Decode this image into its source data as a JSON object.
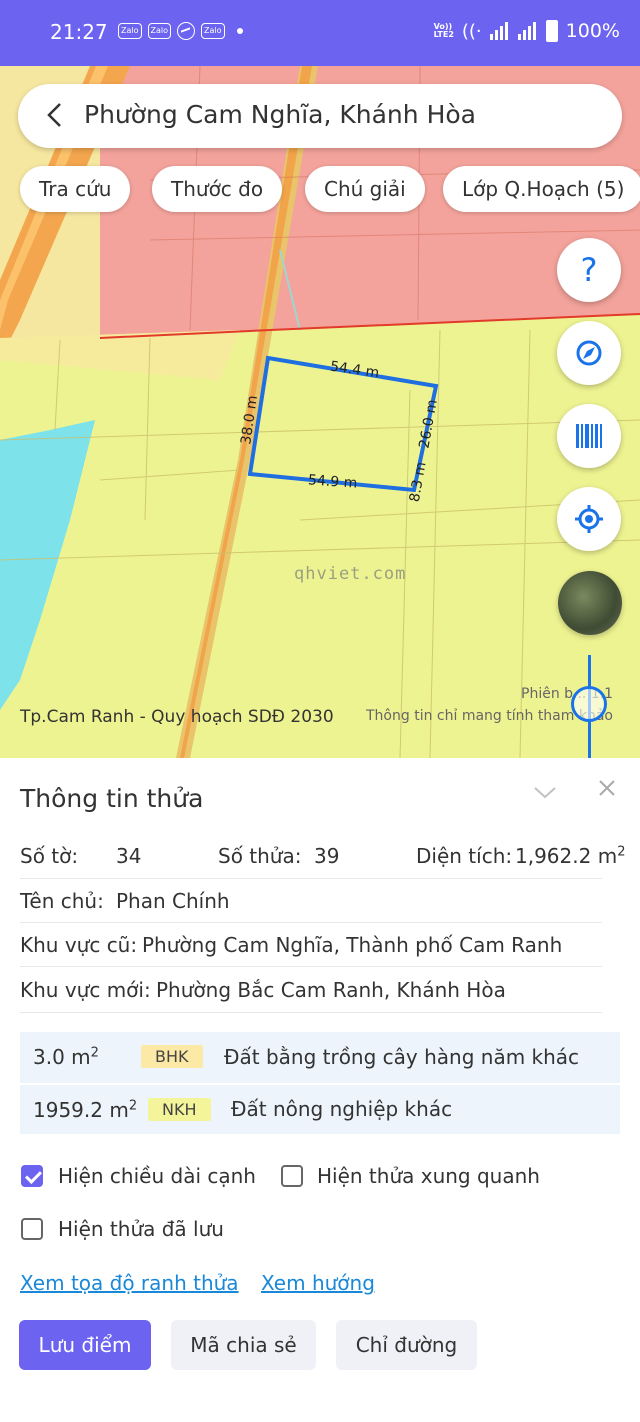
{
  "status_bar": {
    "time": "21:27",
    "app_badges": [
      "Zalo",
      "Zalo",
      "Zalo"
    ],
    "network": "VoLTE LTE2",
    "battery": "100%"
  },
  "search": {
    "title": "Phường Cam Nghĩa, Khánh Hòa"
  },
  "chips": [
    "Tra cứu",
    "Thước đo",
    "Chú giải",
    "Lớp Q.Hoạch (5)"
  ],
  "fabs": {
    "help": "?",
    "compass": "compass-icon",
    "barcode": "barcode-icon",
    "locate": "locate-icon",
    "satellite": "satellite-thumbnail"
  },
  "map": {
    "plan_label": "Tp.Cam Ranh - Quy hoạch SDĐ 2030",
    "version": "Phiên b... 1.1",
    "disclaimer": "Thông tin chỉ mang tính tham khảo",
    "watermark": "qhviet.com",
    "dimensions": {
      "top": "54.4 m",
      "left": "38.0 m",
      "bottom": "54.9 m",
      "right": "26.0 m",
      "right_small": "8.3 m"
    }
  },
  "panel": {
    "title": "Thông tin thửa",
    "so_to_label": "Số tờ:",
    "so_to_value": "34",
    "so_thua_label": "Số thửa:",
    "so_thua_value": "39",
    "dien_tich_label": "Diện tích:",
    "dien_tich_value": "1,962.2 m",
    "dien_tich_sup": "2",
    "owner_label": "Tên chủ:",
    "owner_value": "Phan Chính",
    "old_area_label": "Khu vực cũ:",
    "old_area_value": "Phường Cam Nghĩa, Thành phố Cam Ranh",
    "new_area_label": "Khu vực mới:",
    "new_area_value": "Phường Bắc Cam Ranh, Khánh Hòa",
    "land_uses": [
      {
        "area": "3.0 m",
        "sup": "2",
        "code": "BHK",
        "desc": "Đất bằng trồng cây hàng năm khác",
        "color": "#fde9a6"
      },
      {
        "area": "1959.2 m",
        "sup": "2",
        "code": "NKH",
        "desc": "Đất nông nghiệp khác",
        "color": "#f4f59a"
      }
    ],
    "options": {
      "show_edges": "Hiện chiều dài cạnh",
      "show_edges_checked": true,
      "show_neighbors": "Hiện thửa xung quanh",
      "show_neighbors_checked": false,
      "show_saved": "Hiện thửa đã lưu",
      "show_saved_checked": false
    },
    "links": {
      "coords": "Xem tọa độ ranh thửa",
      "direction": "Xem hướng"
    },
    "buttons": {
      "save": "Lưu điểm",
      "share": "Mã chia sẻ",
      "directions": "Chỉ đường"
    }
  }
}
